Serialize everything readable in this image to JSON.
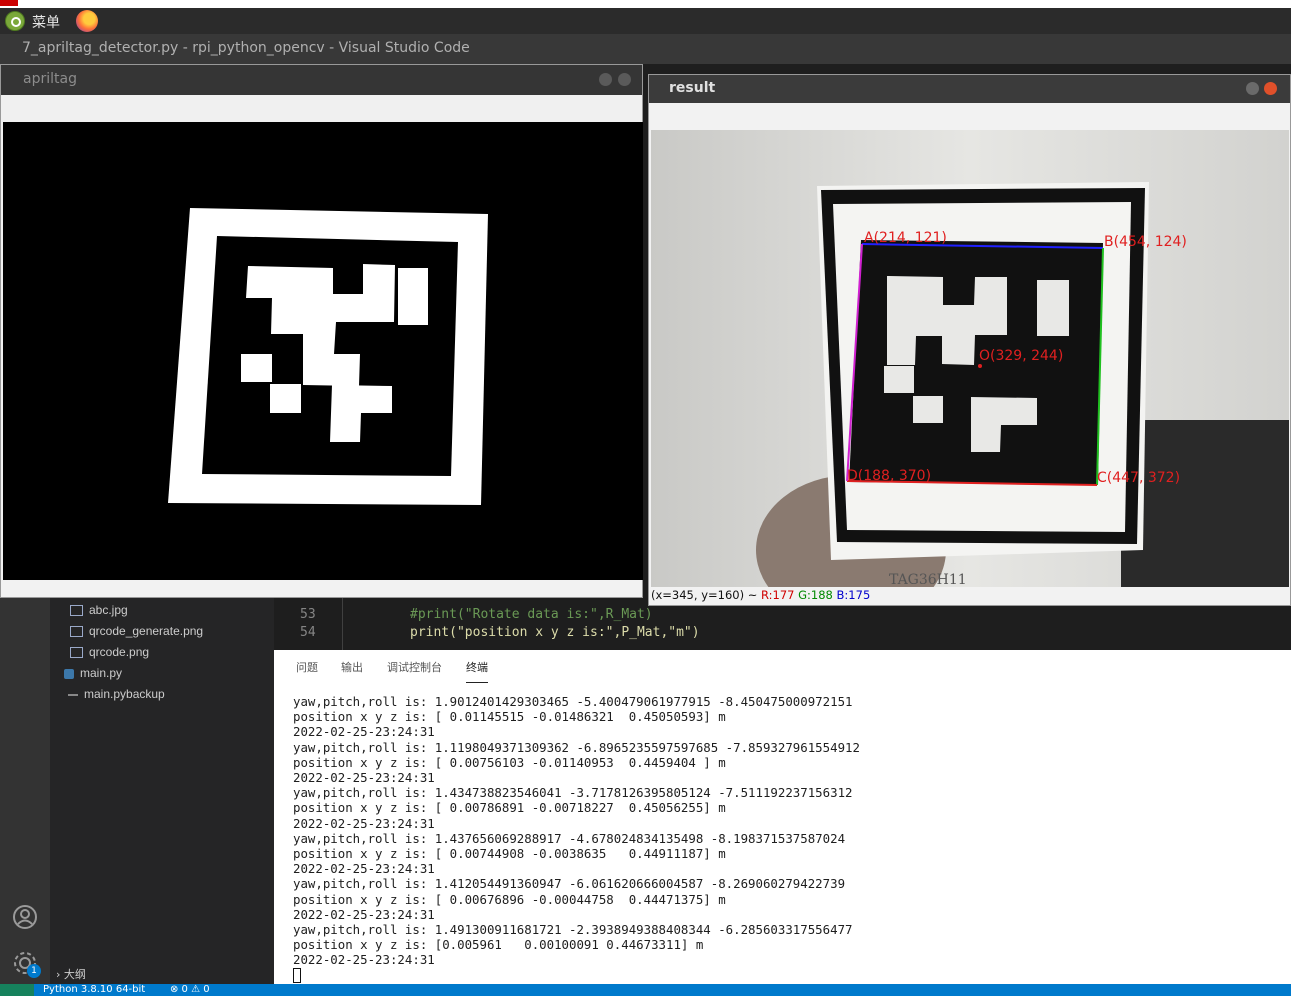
{
  "system_panel": {
    "menu_label": "菜单"
  },
  "vscode": {
    "window_title": "7_apriltag_detector.py - rpi_python_opencv - Visual Studio Code",
    "explorer": {
      "files": [
        {
          "name": "abc.jpg",
          "type": "image"
        },
        {
          "name": "qrcode_generate.png",
          "type": "image"
        },
        {
          "name": "qrcode.png",
          "type": "image"
        },
        {
          "name": "main.py",
          "type": "python"
        },
        {
          "name": "main.pybackup",
          "type": "backup"
        }
      ],
      "outline_label": "大纲"
    },
    "editor": {
      "lines": [
        {
          "num": "53",
          "text": "#print(\"Rotate data is:\",R_Mat)"
        },
        {
          "num": "54",
          "text": "print(\"position x y z is:\",P_Mat,\"m\")"
        }
      ]
    },
    "panel_tabs": [
      "问题",
      "输出",
      "调试控制台",
      "终端"
    ],
    "active_tab": "终端",
    "terminal_lines": [
      "yaw,pitch,roll is: 1.9012401429303465 -5.400479061977915 -8.450475000972151",
      "position x y z is: [ 0.01145515 -0.01486321  0.45050593] m",
      "2022-02-25-23:24:31",
      "yaw,pitch,roll is: 1.1198049371309362 -6.8965235597597685 -7.859327961554912",
      "position x y z is: [ 0.00756103 -0.01140953  0.4459404 ] m",
      "2022-02-25-23:24:31",
      "yaw,pitch,roll is: 1.434738823546041 -3.7178126395805124 -7.511192237156312",
      "position x y z is: [ 0.00786891 -0.00718227  0.45056255] m",
      "2022-02-25-23:24:31",
      "yaw,pitch,roll is: 1.437656069288917 -4.678024834135498 -8.198371537587024",
      "position x y z is: [ 0.00744908 -0.0038635   0.44911187] m",
      "2022-02-25-23:24:31",
      "yaw,pitch,roll is: 1.412054491360947 -6.061620666004587 -8.269060279422739",
      "position x y z is: [ 0.00676896 -0.00044758  0.44471375] m",
      "2022-02-25-23:24:31",
      "yaw,pitch,roll is: 1.491300911681721 -2.3938949388408344 -6.285603317556477",
      "position x y z is: [0.005961   0.00100091 0.44673311] m",
      "2022-02-25-23:24:31"
    ],
    "status": {
      "python": "Python 3.8.10 64-bit",
      "problems": "⊗ 0 ⚠ 0"
    },
    "settings_badge": "1"
  },
  "apriltag_window": {
    "title": "apriltag"
  },
  "result_window": {
    "title": "result",
    "corner_labels": {
      "a": "A(214, 121)",
      "b": "B(454, 124)",
      "c": "C(447, 372)",
      "d": "D(188, 370)",
      "o": "O(329, 244)"
    },
    "tag_caption": "TAG36H11",
    "pixel_info": "(x=345, y=160) ~",
    "pixel_r": "R:177",
    "pixel_g": "G:188",
    "pixel_b": "B:175"
  },
  "colors": {
    "status_bar": "#007acc",
    "label_red": "#e02020",
    "edge_blue": "#2020ff",
    "edge_green": "#20c020",
    "edge_magenta": "#d020d0"
  }
}
